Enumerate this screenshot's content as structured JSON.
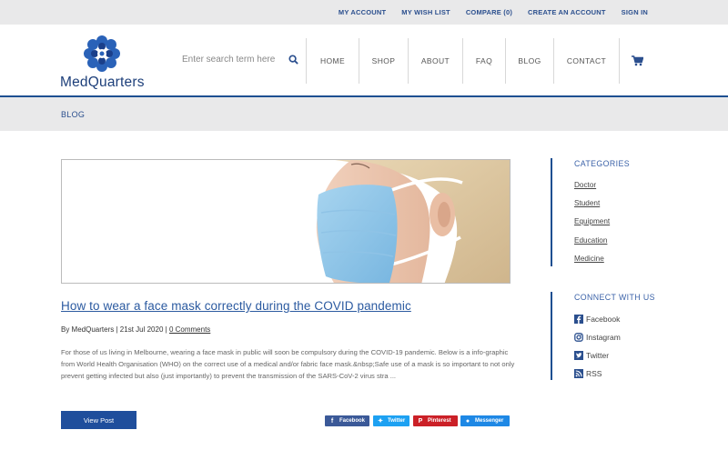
{
  "top_links": [
    "MY ACCOUNT",
    "MY WISH LIST",
    "COMPARE (0)",
    "CREATE AN ACCOUNT",
    "SIGN IN"
  ],
  "logo": {
    "part1": "Med",
    "part2": "Quarters"
  },
  "search": {
    "placeholder": "Enter search term here"
  },
  "nav": [
    {
      "label": "HOME"
    },
    {
      "label": "SHOP"
    },
    {
      "label": "ABOUT"
    },
    {
      "label": "FAQ"
    },
    {
      "label": "BLOG"
    },
    {
      "label": "CONTACT"
    }
  ],
  "breadcrumb": "BLOG",
  "post": {
    "title": "How to wear a face mask correctly during the COVID pandemic",
    "author": "By MedQuarters",
    "sep": "|",
    "date": "21st Jul 2020",
    "comments": "0 Comments",
    "excerpt": "For those of us living in Melbourne, wearing a face mask in public will soon be compulsory during the COVID-19 pandemic. Below is a info-graphic from World Health Organisation (WHO) on the correct use of a medical and/or fabric face mask.&nbsp;Safe use of a mask is so important to not only prevent getting infected but also (just importantly) to prevent the transmission of the SARS-CoV-2 virus stra ...",
    "view_button": "View Post"
  },
  "share": [
    {
      "label": "Facebook",
      "color": "#3b5998"
    },
    {
      "label": "Twitter",
      "color": "#1da1f2"
    },
    {
      "label": "Pinterest",
      "color": "#cb2027"
    },
    {
      "label": "Messenger",
      "color": "#1e88e5"
    }
  ],
  "sidebar": {
    "categories_heading": "CATEGORIES",
    "categories": [
      "Doctor",
      "Student",
      "Equipment",
      "Education",
      "Medicine"
    ],
    "connect_heading": "CONNECT WITH US",
    "social": [
      "Facebook",
      "Instagram",
      "Twitter",
      "RSS"
    ]
  },
  "colors": {
    "brand_blue": "#1d4f91",
    "link_blue": "#2b5aa0",
    "topbar_bg": "#e9e9ea"
  }
}
